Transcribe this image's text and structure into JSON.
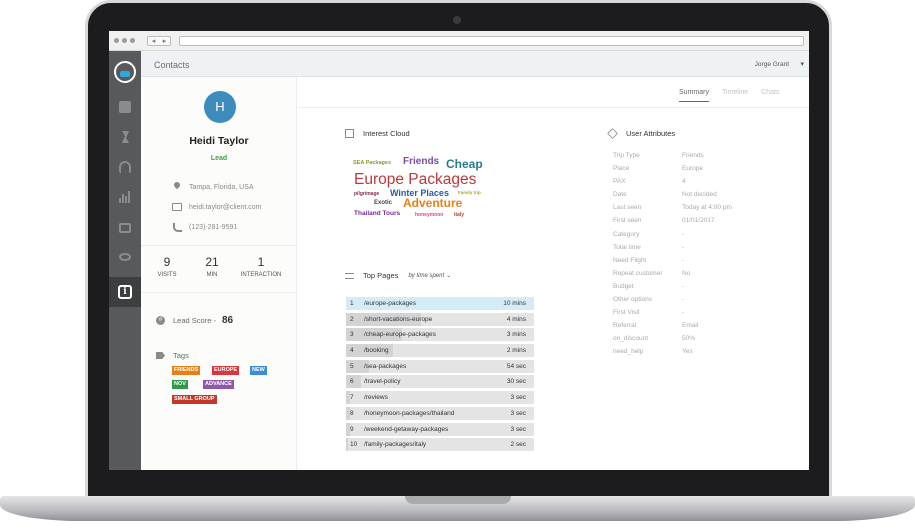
{
  "app": {
    "section_title": "Contacts",
    "user_name": "Jorge Grant",
    "user_caret": "▾"
  },
  "browser": {
    "back": "◂",
    "forward": "▸"
  },
  "sidebar": {
    "items": [
      {
        "name": "logo",
        "icon": "headset-logo-icon"
      },
      {
        "name": "chat",
        "icon": "chat-icon"
      },
      {
        "name": "automation",
        "icon": "bolt-icon"
      },
      {
        "name": "support",
        "icon": "headphones-icon"
      },
      {
        "name": "reports",
        "icon": "bar-chart-icon"
      },
      {
        "name": "billing",
        "icon": "card-icon"
      },
      {
        "name": "monitor",
        "icon": "eye-icon"
      },
      {
        "name": "contact-info",
        "icon": "info-icon",
        "active": true,
        "glyph": "i"
      }
    ],
    "colors": {
      "background": "#58595b",
      "active": "#3d3e40",
      "accent": "#29a9e1"
    }
  },
  "profile": {
    "avatar_initial": "H",
    "avatar_color": "#3c8dbc",
    "name": "Heidi Taylor",
    "status": "Lead",
    "status_color": "#3aa642",
    "location": "Tampa, Florida, USA",
    "email": "heidi.taylor@client.com",
    "phone": "(123)-281-9591",
    "stats": [
      {
        "value": "9",
        "label": "VISITS"
      },
      {
        "value": "21",
        "label": "MIN"
      },
      {
        "value": "1",
        "label": "INTERACTION"
      }
    ],
    "lead_score_label": "Lead Score -",
    "lead_score_icon_glyph": "#",
    "lead_score": "86",
    "tags_label": "Tags",
    "tags": [
      {
        "label": "FRIENDS",
        "color": "#e8801a"
      },
      {
        "label": "EUROPE",
        "color": "#d9373d"
      },
      {
        "label": "NEW",
        "color": "#3c8dd6"
      },
      {
        "label": "NOV",
        "color": "#2f9a4a"
      },
      {
        "label": "ADVANCE",
        "color": "#8e5aa8"
      },
      {
        "label": "SMALL GROUP",
        "color": "#c0392b"
      }
    ]
  },
  "tabs": [
    {
      "label": "Summary",
      "active": true
    },
    {
      "label": "Timeline",
      "active": false
    },
    {
      "label": "Chats",
      "active": false
    }
  ],
  "interest_cloud": {
    "title": "Interest Cloud",
    "words": [
      {
        "text": "SEA Packages",
        "color": "#8a9a2a"
      },
      {
        "text": "Friends",
        "color": "#7a4c9a"
      },
      {
        "text": "Cheap",
        "color": "#2a7a8a"
      },
      {
        "text": "Europe Packages",
        "color": "#b83a3a"
      },
      {
        "text": "pilgrimage",
        "color": "#8a2a4a"
      },
      {
        "text": "Winter Places",
        "color": "#2a5aa8"
      },
      {
        "text": "Family trip",
        "color": "#a8a82a"
      },
      {
        "text": "Exotic",
        "color": "#444444"
      },
      {
        "text": "Adventure",
        "color": "#e8801a"
      },
      {
        "text": "Thailand Tours",
        "color": "#7a2a9a"
      },
      {
        "text": "honeymoon",
        "color": "#d04a8a"
      },
      {
        "text": "italy",
        "color": "#c0392b"
      }
    ]
  },
  "top_pages": {
    "title": "Top Pages",
    "sort_label": "by time spent",
    "sort_caret": "⌄",
    "rows": [
      {
        "rank": "1",
        "path": "/europe-packages",
        "time": "10 mins",
        "share": 1.0
      },
      {
        "rank": "2",
        "path": "/short-vacations-europe",
        "time": "4 mins",
        "share": 0.4
      },
      {
        "rank": "3",
        "path": "/cheap-europe-packages",
        "time": "3 mins",
        "share": 0.3
      },
      {
        "rank": "4",
        "path": "/booking",
        "time": "2 mins",
        "share": 0.25
      },
      {
        "rank": "5",
        "path": "/sea-packages",
        "time": "54 sec",
        "share": 0.12
      },
      {
        "rank": "6",
        "path": "/travel-policy",
        "time": "30 sec",
        "share": 0.08
      },
      {
        "rank": "7",
        "path": "/reviews",
        "time": "3 sec",
        "share": 0.02
      },
      {
        "rank": "8",
        "path": "/honeymoon-packages/thailand",
        "time": "3 sec",
        "share": 0.02
      },
      {
        "rank": "9",
        "path": "/weekend-getaway-packages",
        "time": "3 sec",
        "share": 0.02
      },
      {
        "rank": "10",
        "path": "/family-packages/italy",
        "time": "2 sec",
        "share": 0.01
      }
    ]
  },
  "user_attributes": {
    "title": "User Attributes",
    "rows": [
      {
        "key": "Trip Type",
        "value": "Friends"
      },
      {
        "key": "Place",
        "value": "Europe"
      },
      {
        "key": "PAX",
        "value": "4"
      },
      {
        "key": "Date",
        "value": "Not decided"
      },
      {
        "key": "Last seen",
        "value": "Today at 4:00 pm"
      },
      {
        "key": "First seen",
        "value": "01/01/2017"
      },
      {
        "key": "Category",
        "value": "-"
      },
      {
        "key": "Total time",
        "value": "-"
      },
      {
        "key": "Need Flight",
        "value": "-"
      },
      {
        "key": "Repeat customer",
        "value": "No"
      },
      {
        "key": "Budget",
        "value": "-"
      },
      {
        "key": "Other options",
        "value": "-"
      },
      {
        "key": "First Visit",
        "value": "-"
      },
      {
        "key": "Referral",
        "value": "Email"
      },
      {
        "key": "on_discount",
        "value": "50%"
      },
      {
        "key": "need_help",
        "value": "Yes"
      }
    ]
  }
}
